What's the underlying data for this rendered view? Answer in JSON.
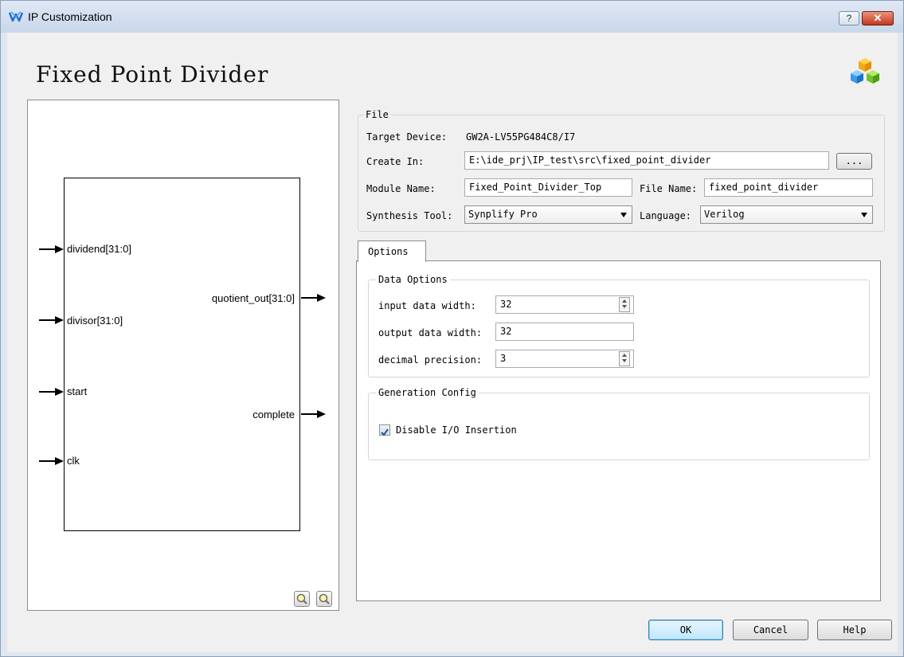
{
  "window": {
    "title": "IP Customization",
    "help_label": "?",
    "close_label": "✕"
  },
  "page_title": "Fixed Point Divider",
  "diagram": {
    "ports_in": [
      "dividend[31:0]",
      "divisor[31:0]",
      "start",
      "clk"
    ],
    "ports_out": [
      "quotient_out[31:0]",
      "complete"
    ]
  },
  "file": {
    "legend": "File",
    "target_device_label": "Target Device:",
    "target_device_value": "GW2A-LV55PG484C8/I7",
    "create_in_label": "Create In:",
    "create_in_value": "E:\\ide_prj\\IP_test\\src\\fixed_point_divider",
    "browse_label": "...",
    "module_name_label": "Module Name:",
    "module_name_value": "Fixed_Point_Divider_Top",
    "file_name_label": "File Name:",
    "file_name_value": "fixed_point_divider",
    "synthesis_tool_label": "Synthesis Tool:",
    "synthesis_tool_value": "Synplify Pro",
    "language_label": "Language:",
    "language_value": "Verilog"
  },
  "tabs": [
    {
      "label": "Options"
    }
  ],
  "data_options": {
    "legend": "Data Options",
    "input_width_label": "input data width:",
    "input_width_value": "32",
    "output_width_label": "output data width:",
    "output_width_value": "32",
    "decimal_precision_label": "decimal precision:",
    "decimal_precision_value": "3"
  },
  "generation_config": {
    "legend": "Generation Config",
    "disable_io_label": "Disable I/O Insertion",
    "disable_io_checked": true
  },
  "buttons": {
    "ok": "OK",
    "cancel": "Cancel",
    "help": "Help"
  }
}
